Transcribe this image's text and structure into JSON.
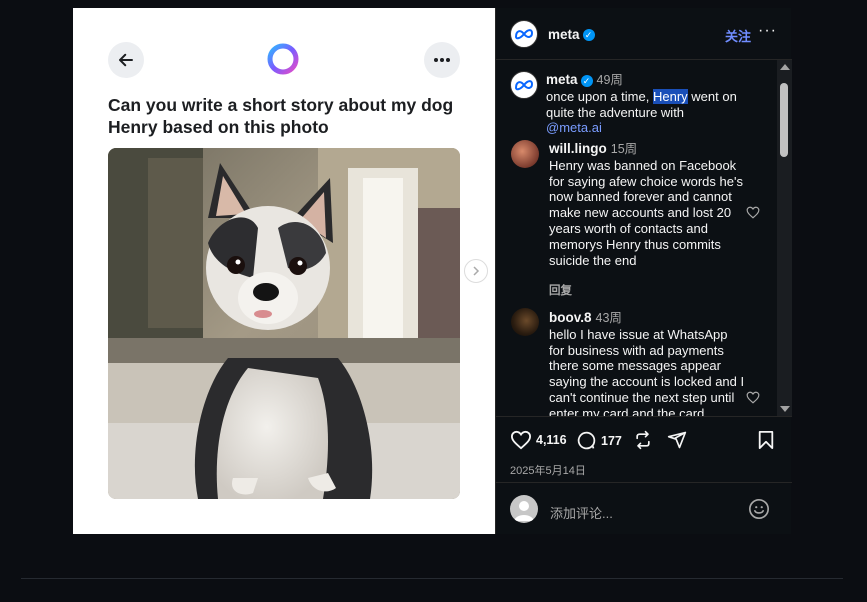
{
  "left": {
    "question": "Can you write a short story about my dog Henry based on this photo"
  },
  "header": {
    "username": "meta",
    "follow_label": "关注",
    "more_label": "···"
  },
  "caption": {
    "username": "meta",
    "time": "49周",
    "text_before": "once upon a time, ",
    "highlight": "Henry",
    "text_after": " went on quite the adventure with ",
    "mention": "@meta.ai"
  },
  "comments": [
    {
      "username": "will.lingo",
      "time": "15周",
      "text": "Henry was banned on Facebook for saying afew choice words he's now banned forever and cannot make new accounts and lost 20 years worth of contacts and memorys Henry thus commits suicide the end",
      "reply_label": "回复"
    },
    {
      "username": "boov.8",
      "time": "43周",
      "text": "hello I have issue at WhatsApp for business with ad payments there some messages appear saying the account is locked and I can't continue the next step until enter my card and the card"
    }
  ],
  "actions": {
    "likes": "4,116",
    "comments": "177",
    "date": "2025年5月14日"
  },
  "add_comment": {
    "placeholder": "添加评论..."
  },
  "colors": {
    "accent": "#0095f6",
    "follow": "#708dff",
    "panel_bg": "#0c1014",
    "page_bg": "#0b0d12"
  }
}
